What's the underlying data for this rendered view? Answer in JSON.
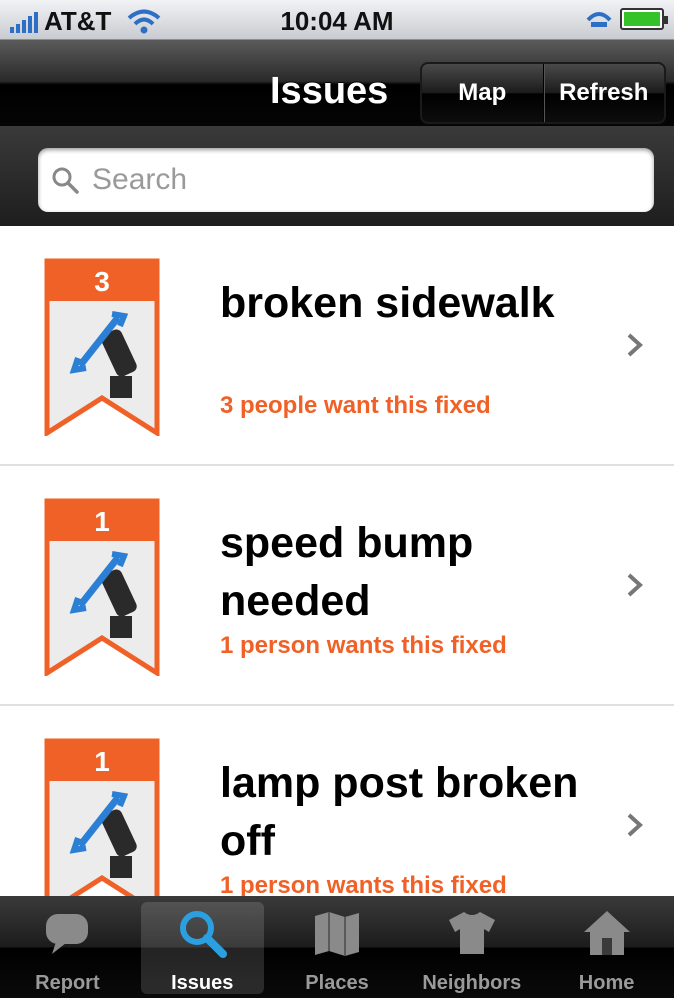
{
  "status_bar": {
    "carrier": "AT&T",
    "time": "10:04 AM"
  },
  "nav": {
    "title": "Issues",
    "map_label": "Map",
    "refresh_label": "Refresh"
  },
  "search": {
    "placeholder": "Search",
    "value": ""
  },
  "issues": [
    {
      "count": "3",
      "title": "broken sidewalk",
      "subtitle": "3 people want this fixed"
    },
    {
      "count": "1",
      "title": "speed bump needed",
      "subtitle": "1 person wants this fixed"
    },
    {
      "count": "1",
      "title": "lamp post broken off",
      "subtitle": "1 person wants this fixed"
    }
  ],
  "tabs": [
    {
      "label": "Report",
      "icon": "speech-bubble-icon",
      "active": false
    },
    {
      "label": "Issues",
      "icon": "magnifier-icon",
      "active": true
    },
    {
      "label": "Places",
      "icon": "map-icon",
      "active": false
    },
    {
      "label": "Neighbors",
      "icon": "tshirt-icon",
      "active": false
    },
    {
      "label": "Home",
      "icon": "house-icon",
      "active": false
    }
  ],
  "colors": {
    "accent": "#ef6126",
    "active_tab_icon": "#2b9fe0"
  }
}
